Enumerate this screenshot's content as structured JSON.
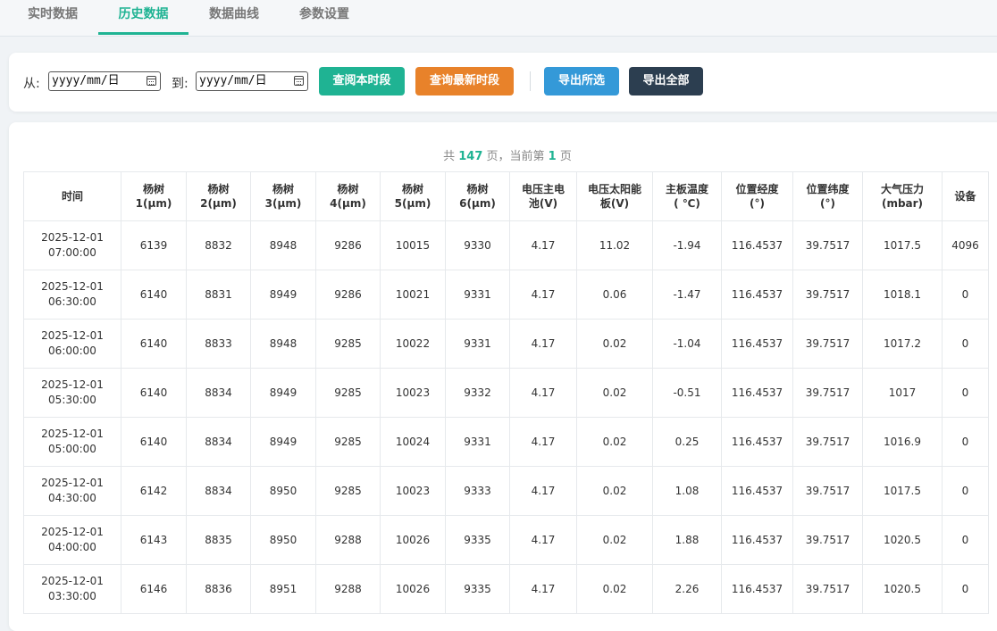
{
  "tabs": [
    {
      "label": "实时数据"
    },
    {
      "label": "历史数据"
    },
    {
      "label": "数据曲线"
    },
    {
      "label": "参数设置"
    }
  ],
  "query": {
    "from_label": "从:",
    "to_label": "到:",
    "date_placeholder": "yyyy/mm/日",
    "buttons": {
      "query_period": "查阅本时段",
      "query_latest": "查询最新时段",
      "export_selected": "导出所选",
      "export_all": "导出全部"
    }
  },
  "paging": {
    "prefix": "共 ",
    "total_pages": "147",
    "middle": " 页，当前第 ",
    "current_page": "1",
    "suffix": " 页"
  },
  "table": {
    "headers": [
      {
        "line1": "时间",
        "line2": ""
      },
      {
        "line1": "杨树",
        "line2": "1(μm)"
      },
      {
        "line1": "杨树",
        "line2": "2(μm)"
      },
      {
        "line1": "杨树",
        "line2": "3(μm)"
      },
      {
        "line1": "杨树",
        "line2": "4(μm)"
      },
      {
        "line1": "杨树",
        "line2": "5(μm)"
      },
      {
        "line1": "杨树",
        "line2": "6(μm)"
      },
      {
        "line1": "电压主电",
        "line2": "池(V)"
      },
      {
        "line1": "电压太阳能",
        "line2": "板(V)"
      },
      {
        "line1": "主板温度",
        "line2": "( ℃)"
      },
      {
        "line1": "位置经度",
        "line2": "(°)"
      },
      {
        "line1": "位置纬度",
        "line2": "(°)"
      },
      {
        "line1": "大气压力",
        "line2": "(mbar)"
      },
      {
        "line1": "设备",
        "line2": ""
      }
    ],
    "rows": [
      {
        "date": "2025-12-01",
        "time": "07:00:00",
        "cells": [
          "6139",
          "8832",
          "8948",
          "9286",
          "10015",
          "9330",
          "4.17",
          "11.02",
          "-1.94",
          "116.4537",
          "39.7517",
          "1017.5",
          "4096"
        ]
      },
      {
        "date": "2025-12-01",
        "time": "06:30:00",
        "cells": [
          "6140",
          "8831",
          "8949",
          "9286",
          "10021",
          "9331",
          "4.17",
          "0.06",
          "-1.47",
          "116.4537",
          "39.7517",
          "1018.1",
          "0"
        ]
      },
      {
        "date": "2025-12-01",
        "time": "06:00:00",
        "cells": [
          "6140",
          "8833",
          "8948",
          "9285",
          "10022",
          "9331",
          "4.17",
          "0.02",
          "-1.04",
          "116.4537",
          "39.7517",
          "1017.2",
          "0"
        ]
      },
      {
        "date": "2025-12-01",
        "time": "05:30:00",
        "cells": [
          "6140",
          "8834",
          "8949",
          "9285",
          "10023",
          "9332",
          "4.17",
          "0.02",
          "-0.51",
          "116.4537",
          "39.7517",
          "1017",
          "0"
        ]
      },
      {
        "date": "2025-12-01",
        "time": "05:00:00",
        "cells": [
          "6140",
          "8834",
          "8949",
          "9285",
          "10024",
          "9331",
          "4.17",
          "0.02",
          "0.25",
          "116.4537",
          "39.7517",
          "1016.9",
          "0"
        ]
      },
      {
        "date": "2025-12-01",
        "time": "04:30:00",
        "cells": [
          "6142",
          "8834",
          "8950",
          "9285",
          "10023",
          "9333",
          "4.17",
          "0.02",
          "1.08",
          "116.4537",
          "39.7517",
          "1017.5",
          "0"
        ]
      },
      {
        "date": "2025-12-01",
        "time": "04:00:00",
        "cells": [
          "6143",
          "8835",
          "8950",
          "9288",
          "10026",
          "9335",
          "4.17",
          "0.02",
          "1.88",
          "116.4537",
          "39.7517",
          "1020.5",
          "0"
        ]
      },
      {
        "date": "2025-12-01",
        "time": "03:30:00",
        "cells": [
          "6146",
          "8836",
          "8951",
          "9288",
          "10026",
          "9335",
          "4.17",
          "0.02",
          "2.26",
          "116.4537",
          "39.7517",
          "1020.5",
          "0"
        ]
      }
    ]
  },
  "colors": {
    "accent": "#1fb393",
    "query_period": "#1fb393",
    "query_latest": "#e8822a",
    "export_selected": "#3499d8",
    "export_all": "#2c3e50"
  }
}
